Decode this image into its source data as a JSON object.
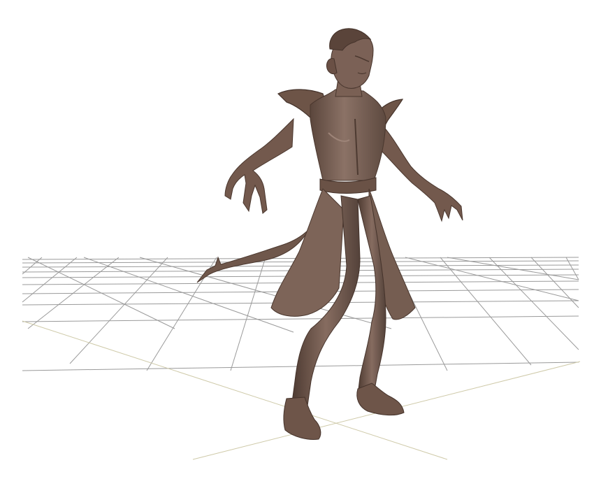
{
  "viewport": {
    "background": "#ffffff",
    "grid_color": "#9a9a9a",
    "axis_color": "#c9c4a6",
    "model_color": "#7a6357",
    "model_shadow_color": "#4f3d34",
    "model_highlight_color": "#a58c7f",
    "show_grid": true,
    "model_name_icon": "sculpted-creature-figure"
  }
}
